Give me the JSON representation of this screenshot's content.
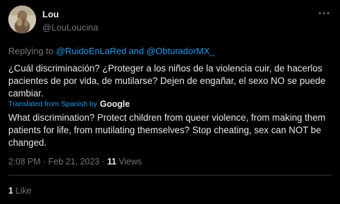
{
  "author": {
    "name": "Lou",
    "handle": "@LouLoucina"
  },
  "reply": {
    "prefix": "Replying to ",
    "user1": "@RuidoEnLaRed",
    "joiner": " and ",
    "user2": "@ObturadorMX_"
  },
  "tweet": {
    "text": "¿Cuál discriminación? ¿Proteger a los niños de la violencia cuir, de hacerlos pacientes de por vida, de mutilarse? Dejen de engañar, el sexo NO se puede cambiar.",
    "translated_label": "Translated from Spanish by",
    "translator": "Google",
    "translation": "What discrimination? Protect children from queer violence, from making them patients for life, from mutilating themselves? Stop cheating, sex can NOT be changed."
  },
  "meta": {
    "time": "2:08 PM",
    "separator": " · ",
    "date": "Feb 21, 2023",
    "views_count": "11",
    "views_label": " Views"
  },
  "stats": {
    "likes_count": "1",
    "likes_label": " Like"
  },
  "colors": {
    "background": "#000000",
    "text": "#e7e9ea",
    "muted": "#71767b",
    "link": "#1d9bf0",
    "divider": "#2f3336"
  },
  "icons": {
    "more": "more-horizontal-icon",
    "avatar": "profile-avatar"
  }
}
